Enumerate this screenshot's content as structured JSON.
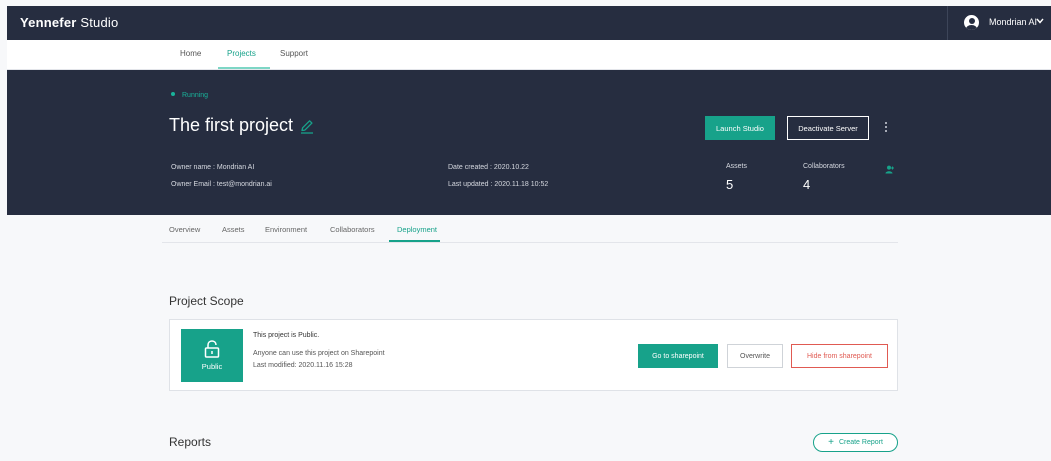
{
  "app": {
    "brand_main": "Yennefer",
    "brand_suffix": " Studio"
  },
  "user": {
    "name": "Mondrian AI"
  },
  "main_nav": {
    "items": [
      "Home",
      "Projects",
      "Support"
    ],
    "active": "Projects"
  },
  "project": {
    "status": "Running",
    "title": "The first project",
    "owner_name": "Owner name :  Mondrian AI",
    "owner_email": "Owner Email :  test@mondrian.ai",
    "date_created": "Date created :  2020.10.22",
    "last_updated": "Last updated :  2020.11.18 10:52",
    "assets_label": "Assets",
    "assets_value": "5",
    "collaborators_label": "Collaborators",
    "collaborators_value": "4",
    "launch_label": "Launch Studio",
    "deactivate_label": "Deactivate Server"
  },
  "tabs": {
    "items": [
      "Overview",
      "Assets",
      "Environment",
      "Collaborators",
      "Deployment"
    ],
    "active": "Deployment"
  },
  "scope": {
    "section_title": "Project Scope",
    "badge_label": "Public",
    "line1": "This project is Public.",
    "line2": "Anyone can use this project on Sharepoint",
    "line3": "Last modified:  2020.11.16 15:28",
    "goto_label": "Go to sharepoint",
    "overwrite_label": "Overwrite",
    "hide_label": "Hide from sharepoint"
  },
  "reports": {
    "section_title": "Reports",
    "create_label": "Create Report"
  },
  "colors": {
    "accent": "#17a28a",
    "header_bg": "#262d40",
    "danger": "#e05a52"
  }
}
